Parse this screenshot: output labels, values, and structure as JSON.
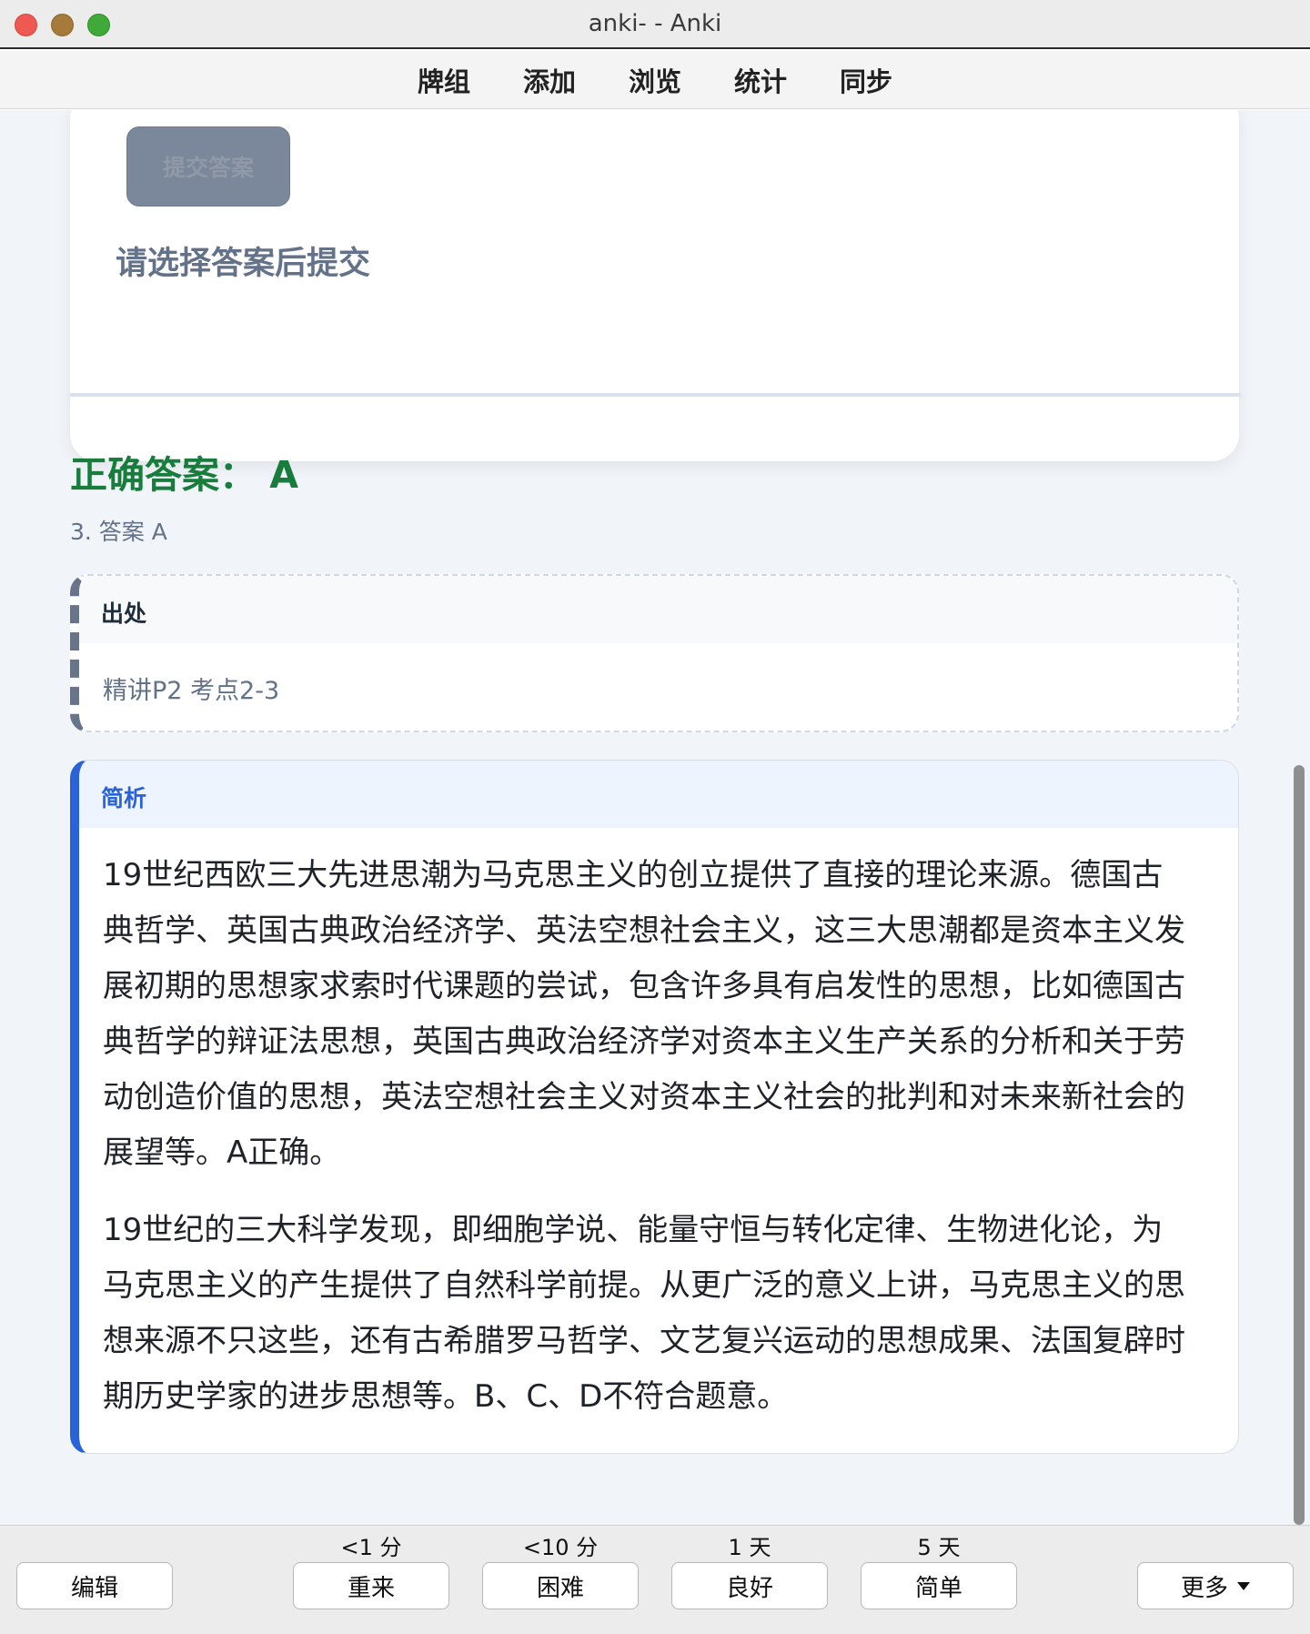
{
  "window": {
    "title": "anki- - Anki"
  },
  "toolbar": {
    "items": [
      "牌组",
      "添加",
      "浏览",
      "统计",
      "同步"
    ]
  },
  "card": {
    "submit_label": "提交答案",
    "hint": "请选择答案后提交"
  },
  "answer": {
    "correct": "正确答案：  A",
    "option_text": "3. 答案 A"
  },
  "source": {
    "heading": "出处",
    "text": "精讲P2 考点2-3"
  },
  "analysis": {
    "heading": "简析",
    "paragraphs": [
      "19世纪西欧三大先进思潮为马克思主义的创立提供了直接的理论来源。德国古典哲学、英国古典政治经济学、英法空想社会主义，这三大思潮都是资本主义发展初期的思想家求索时代课题的尝试，包含许多具有启发性的思想，比如德国古典哲学的辩证法思想，英国古典政治经济学对资本主义生产关系的分析和关于劳动创造价值的思想，英法空想社会主义对资本主义社会的批判和对未来新社会的展望等。A正确。",
      "19世纪的三大科学发现，即细胞学说、能量守恒与转化定律、生物进化论，为马克思主义的产生提供了自然科学前提。从更广泛的意义上讲，马克思主义的思想来源不只这些，还有古希腊罗马哲学、文艺复兴运动的思想成果、法国复辟时期历史学家的进步思想等。B、C、D不符合题意。"
    ]
  },
  "bottom": {
    "edit": "编辑",
    "more": "更多",
    "ease": [
      {
        "label": "重来",
        "interval": "<1 分"
      },
      {
        "label": "困难",
        "interval": "<10 分"
      },
      {
        "label": "良好",
        "interval": "1 天"
      },
      {
        "label": "简单",
        "interval": "5 天"
      }
    ]
  }
}
